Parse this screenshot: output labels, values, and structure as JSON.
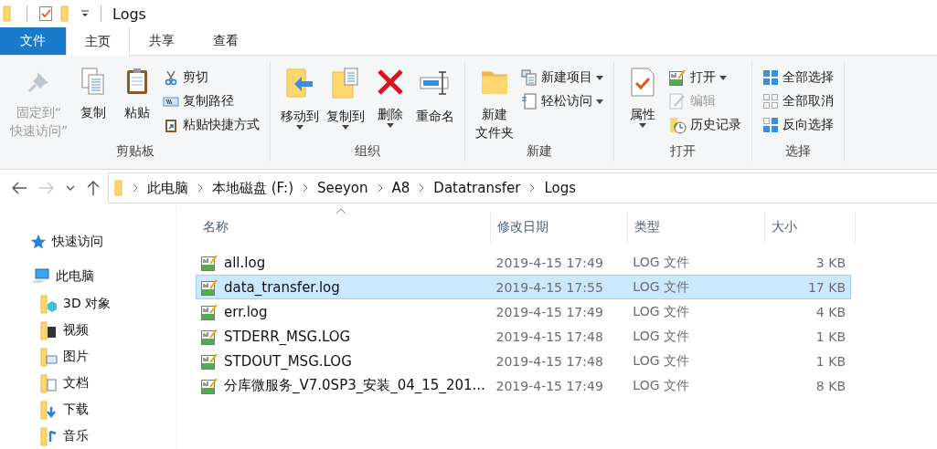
{
  "window": {
    "title": "Logs"
  },
  "ribbon_tabs": [
    {
      "label": "文件",
      "kind": "file",
      "selected": false
    },
    {
      "label": "主页",
      "kind": "tab",
      "selected": true
    },
    {
      "label": "共享",
      "kind": "tab",
      "selected": false
    },
    {
      "label": "查看",
      "kind": "tab",
      "selected": false
    }
  ],
  "ribbon_groups": [
    {
      "label": "剪贴板",
      "items": [
        {
          "label": [
            "固定到“",
            "快速访问”"
          ],
          "kind": "large",
          "disabled": true,
          "dropdown": false
        },
        {
          "label": [
            "复制"
          ],
          "kind": "large",
          "disabled": false,
          "dropdown": false
        },
        {
          "label": [
            "粘贴"
          ],
          "kind": "large",
          "disabled": false,
          "dropdown": false
        },
        {
          "label": "剪切",
          "kind": "small",
          "disabled": false,
          "dropdown": false
        },
        {
          "label": "复制路径",
          "kind": "small",
          "disabled": false,
          "dropdown": false
        },
        {
          "label": "粘贴快捷方式",
          "kind": "small",
          "disabled": false,
          "dropdown": false
        }
      ]
    },
    {
      "label": "组织",
      "items": [
        {
          "label": [
            "移动到"
          ],
          "kind": "large",
          "disabled": false,
          "dropdown": true
        },
        {
          "label": [
            "复制到"
          ],
          "kind": "large",
          "disabled": false,
          "dropdown": true
        },
        {
          "label": [
            "删除"
          ],
          "kind": "large",
          "disabled": false,
          "dropdown": true
        },
        {
          "label": [
            "重命名"
          ],
          "kind": "large",
          "disabled": false,
          "dropdown": false
        }
      ]
    },
    {
      "label": "新建",
      "items": [
        {
          "label": [
            "新建",
            "文件夹"
          ],
          "kind": "large",
          "disabled": false,
          "dropdown": false
        },
        {
          "label": "新建项目",
          "kind": "small",
          "disabled": false,
          "dropdown": true
        },
        {
          "label": "轻松访问",
          "kind": "small",
          "disabled": false,
          "dropdown": true
        }
      ]
    },
    {
      "label": "打开",
      "items": [
        {
          "label": [
            "属性"
          ],
          "kind": "large",
          "disabled": false,
          "dropdown": true
        },
        {
          "label": "打开",
          "kind": "small",
          "disabled": false,
          "dropdown": true
        },
        {
          "label": "编辑",
          "kind": "small",
          "disabled": true,
          "dropdown": false
        },
        {
          "label": "历史记录",
          "kind": "small",
          "disabled": false,
          "dropdown": false
        }
      ]
    },
    {
      "label": "选择",
      "items": [
        {
          "label": "全部选择",
          "kind": "small",
          "disabled": false,
          "dropdown": false
        },
        {
          "label": "全部取消",
          "kind": "small",
          "disabled": false,
          "dropdown": false
        },
        {
          "label": "反向选择",
          "kind": "small",
          "disabled": false,
          "dropdown": false
        }
      ]
    }
  ],
  "nav_buttons": [
    {
      "kind": "back",
      "disabled": false
    },
    {
      "kind": "forward",
      "disabled": true
    },
    {
      "kind": "recent",
      "disabled": false
    },
    {
      "kind": "up",
      "disabled": false
    }
  ],
  "address": {
    "segments": [
      "此电脑",
      "本地磁盘 (F:)",
      "Seeyon",
      "A8",
      "Datatransfer",
      "Logs"
    ]
  },
  "navigation": {
    "items": [
      {
        "label": "快速访问"
      },
      {
        "label": "此电脑",
        "children": [
          {
            "label": "3D 对象"
          },
          {
            "label": "视频"
          },
          {
            "label": "图片"
          },
          {
            "label": "文档"
          },
          {
            "label": "下载"
          },
          {
            "label": "音乐"
          }
        ]
      }
    ]
  },
  "columns": [
    {
      "label": "名称",
      "sorted": true
    },
    {
      "label": "修改日期",
      "sorted": false
    },
    {
      "label": "类型",
      "sorted": false
    },
    {
      "label": "大小",
      "sorted": false
    }
  ],
  "files": [
    {
      "name": "all.log",
      "modified": "2019-4-15 17:49",
      "type": "LOG 文件",
      "size": "3 KB",
      "selected": false
    },
    {
      "name": "data_transfer.log",
      "modified": "2019-4-15 17:55",
      "type": "LOG 文件",
      "size": "17 KB",
      "selected": true
    },
    {
      "name": "err.log",
      "modified": "2019-4-15 17:49",
      "type": "LOG 文件",
      "size": "4 KB",
      "selected": false
    },
    {
      "name": "STDERR_MSG.LOG",
      "modified": "2019-4-15 17:48",
      "type": "LOG 文件",
      "size": "1 KB",
      "selected": false
    },
    {
      "name": "STDOUT_MSG.LOG",
      "modified": "2019-4-15 17:48",
      "type": "LOG 文件",
      "size": "1 KB",
      "selected": false
    },
    {
      "name": "分库微服务_V7.0SP3_安装_04_15_201...",
      "modified": "2019-4-15 17:49",
      "type": "LOG 文件",
      "size": "8 KB",
      "selected": false
    }
  ]
}
